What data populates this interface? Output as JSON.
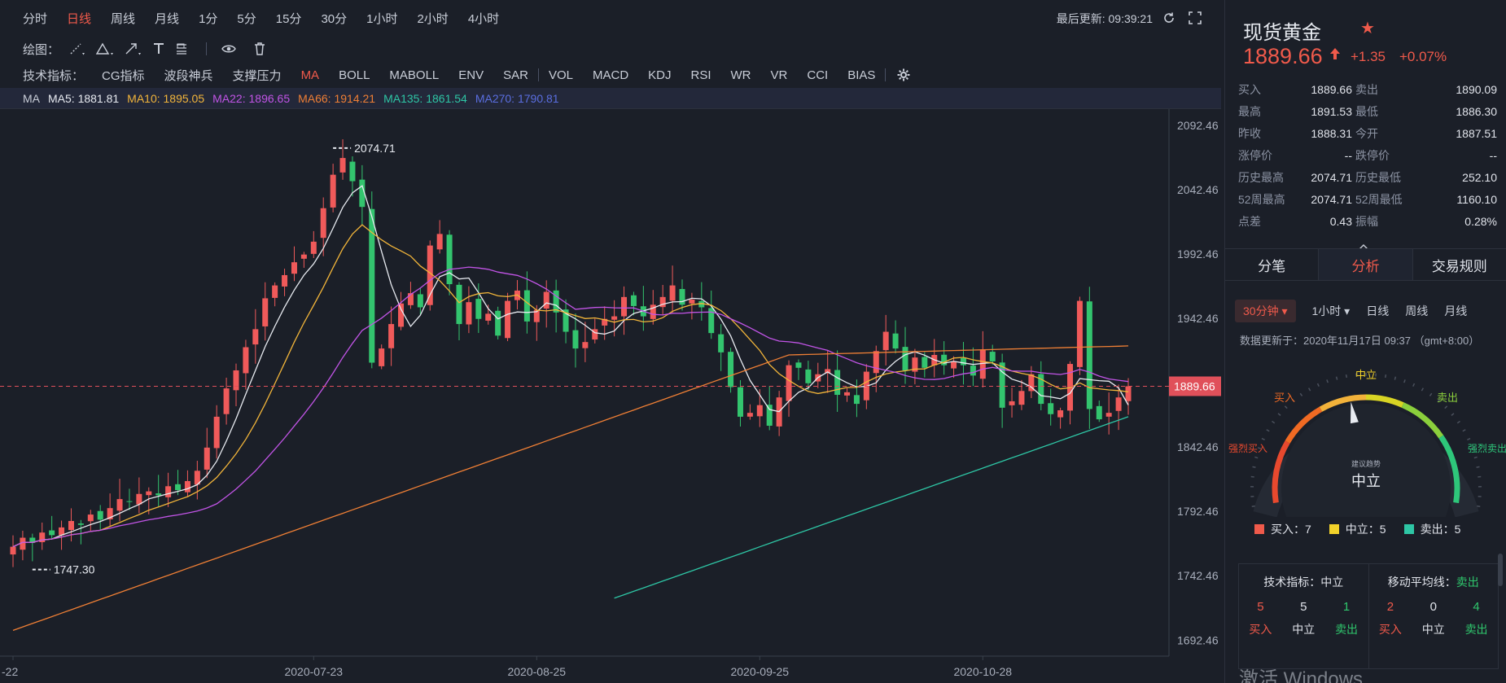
{
  "periods": [
    "分时",
    "日线",
    "周线",
    "月线",
    "1分",
    "5分",
    "15分",
    "30分",
    "1小时",
    "2小时",
    "4小时"
  ],
  "active_period": 1,
  "last_update": "最后更新: 09:39:21",
  "draw_label": "绘图：",
  "indicator_label": "技术指标：",
  "indicators": [
    "CG指标",
    "波段神兵",
    "支撑压力",
    "MA",
    "BOLL",
    "MABOLL",
    "ENV",
    "SAR",
    "VOL",
    "MACD",
    "KDJ",
    "RSI",
    "WR",
    "VR",
    "CCI",
    "BIAS"
  ],
  "active_indicator": 3,
  "ma_line": {
    "label": "MA",
    "items": [
      {
        "text": "MA5: 1881.81",
        "color": "#e8ebf1"
      },
      {
        "text": "MA10: 1895.05",
        "color": "#f2b53a"
      },
      {
        "text": "MA22: 1896.65",
        "color": "#c154e6"
      },
      {
        "text": "MA66: 1914.21",
        "color": "#ef7f35"
      },
      {
        "text": "MA135: 1861.54",
        "color": "#2ec6a5"
      },
      {
        "text": "MA270: 1790.81",
        "color": "#5a6ee0"
      }
    ]
  },
  "chart_data": {
    "type": "candlestick",
    "y_ticks": [
      "2092.46",
      "2042.46",
      "1992.46",
      "1942.46",
      "1842.46",
      "1792.46",
      "1742.46",
      "1692.46"
    ],
    "y_tick_values": [
      2092.46,
      2042.46,
      1992.46,
      1942.46,
      1842.46,
      1792.46,
      1742.46,
      1692.46
    ],
    "ylim": [
      1680,
      2105
    ],
    "x_ticks": [
      "-22",
      "2020-07-23",
      "2020-08-25",
      "2020-09-25",
      "2020-10-28"
    ],
    "x_tick_index": [
      0,
      31,
      54,
      77,
      100
    ],
    "current_price_label": "1889.66",
    "current_price": 1889.66,
    "high_label": "2074.71",
    "high_value": 2074.71,
    "high_index": 33,
    "low_label": "1747.30",
    "low_value": 1747.3,
    "low_index": 2,
    "n": 106,
    "closes": [
      1765,
      1772,
      1768,
      1776,
      1774,
      1780,
      1785,
      1782,
      1790,
      1786,
      1795,
      1802,
      1800,
      1806,
      1808,
      1805,
      1812,
      1809,
      1816,
      1824,
      1842,
      1866,
      1888,
      1902,
      1920,
      1934,
      1958,
      1968,
      1976,
      1986,
      1992,
      2002,
      2028,
      2054,
      2067,
      2049,
      2029,
      1908,
      1919,
      1938,
      1954,
      1962,
      1951,
      1999,
      2008,
      1969,
      1938,
      1955,
      1942,
      1946,
      1929,
      1956,
      1964,
      1940,
      1949,
      1963,
      1947,
      1932,
      1919,
      1924,
      1934,
      1942,
      1944,
      1959,
      1952,
      1944,
      1953,
      1959,
      1968,
      1953,
      1957,
      1951,
      1931,
      1916,
      1889,
      1866,
      1869,
      1875,
      1859,
      1881,
      1906,
      1904,
      1892,
      1899,
      1903,
      1883,
      1885,
      1876,
      1901,
      1917,
      1932,
      1919,
      1902,
      1912,
      1904,
      1914,
      1906,
      1909,
      1906,
      1898,
      1918,
      1909,
      1873,
      1878,
      1886,
      1899,
      1876,
      1868,
      1871,
      1907,
      1956,
      1872,
      1864,
      1869,
      1881,
      1889.66
    ],
    "ma_series_colors": [
      "#e8ebf1",
      "#f2b53a",
      "#c154e6",
      "#ef7f35",
      "#2ec6a5"
    ]
  },
  "info": {
    "name": "现货黄金",
    "price": "1889.66",
    "change": "+1.35",
    "change_pct": "+0.07%",
    "rows": [
      [
        "买入",
        "1889.66",
        "卖出",
        "1890.09"
      ],
      [
        "最高",
        "1891.53",
        "最低",
        "1886.30"
      ],
      [
        "昨收",
        "1888.31",
        "今开",
        "1887.51"
      ],
      [
        "涨停价",
        "--",
        "跌停价",
        "--"
      ],
      [
        "历史最高",
        "2074.71",
        "历史最低",
        "252.10"
      ],
      [
        "52周最高",
        "2074.71",
        "52周最低",
        "1160.10"
      ],
      [
        "点差",
        "0.43",
        "振幅",
        "0.28%"
      ]
    ]
  },
  "tabs": [
    "分笔",
    "分析",
    "交易规则"
  ],
  "active_tab": 1,
  "analysis": {
    "periods": [
      "30分钟",
      "1小时",
      "日线",
      "周线",
      "月线"
    ],
    "active_period": 0,
    "update_note": "数据更新于：2020年11月17日 09:37 （gmt+8:00）",
    "gauge_labels": {
      "top": "中立",
      "left": "买入",
      "right": "卖出",
      "far_left": "强烈买入",
      "far_right": "强烈卖出",
      "center_small": "建议趋势",
      "center": "中立"
    },
    "gauge_value": 0.45,
    "legend": [
      {
        "text": "买入：7",
        "color": "#f05a4b"
      },
      {
        "text": "中立：5",
        "color": "#f2d22a"
      },
      {
        "text": "卖出：5",
        "color": "#2ec6a5"
      }
    ],
    "tech": {
      "title": "技术指标：",
      "result": "中立",
      "nums": [
        "5",
        "5",
        "1"
      ],
      "labels": [
        "买入",
        "中立",
        "卖出"
      ]
    },
    "ma": {
      "title": "移动平均线：",
      "result": "卖出",
      "nums": [
        "2",
        "0",
        "4"
      ],
      "labels": [
        "买入",
        "中立",
        "卖出"
      ]
    }
  },
  "watermark": "激活 Windows"
}
